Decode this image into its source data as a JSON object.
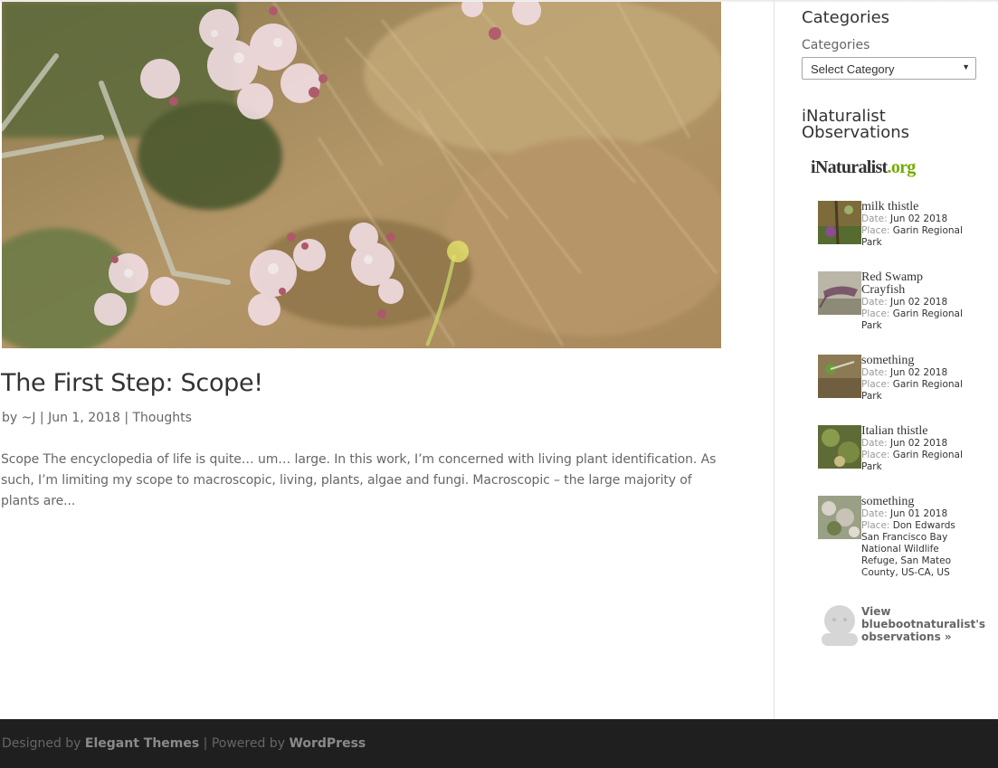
{
  "post": {
    "title": "The First Step: Scope!",
    "meta": {
      "by": "by ",
      "author": "~J",
      "sep1": " | ",
      "date": "Jun 1, 2018",
      "sep2": " | ",
      "category": "Thoughts"
    },
    "excerpt": "Scope The encyclopedia of life is quite… um… large. In this work, I’m concerned with living plant identification. As such, I’m limiting my scope to macroscopic, living, plants, algae and fungi. Macroscopic – the large majority of plants are..."
  },
  "sidebar": {
    "categories": {
      "title": "Categories",
      "label": "Categories",
      "selected": "Select Category"
    },
    "inaturalist": {
      "title": "iNaturalist Observations",
      "logo_name": "iNaturalist",
      "logo_domain": ".org",
      "observations": [
        {
          "name": "milk thistle",
          "date_label": "Date: ",
          "date": "Jun 02 2018",
          "place_label": "Place: ",
          "place": "Garin Regional Park"
        },
        {
          "name": "Red Swamp Crayfish",
          "date_label": "Date: ",
          "date": "Jun 02 2018",
          "place_label": "Place: ",
          "place": "Garin Regional Park"
        },
        {
          "name": "something",
          "date_label": "Date: ",
          "date": "Jun 02 2018",
          "place_label": "Place: ",
          "place": "Garin Regional Park"
        },
        {
          "name": "Italian thistle",
          "date_label": "Date: ",
          "date": "Jun 02 2018",
          "place_label": "Place: ",
          "place": "Garin Regional Park"
        },
        {
          "name": "something",
          "date_label": "Date: ",
          "date": "Jun 01 2018",
          "place_label": "Place: ",
          "place": "Don Edwards San Francisco Bay National Wildlife Refuge, San Mateo County, US-CA, US"
        }
      ],
      "view_link": "View bluebootnaturalist's observations »"
    }
  },
  "footer": {
    "designed_by": "Designed by ",
    "elegant": "Elegant Themes",
    "powered_by": " | Powered by ",
    "wordpress": "WordPress"
  },
  "colors": {
    "footer_bg": "#1f1f1f",
    "inat_green": "#74ac00",
    "title": "#333333",
    "body_text": "#666666"
  },
  "icons": [
    "avatar-icon",
    "dropdown-arrow-icon"
  ]
}
